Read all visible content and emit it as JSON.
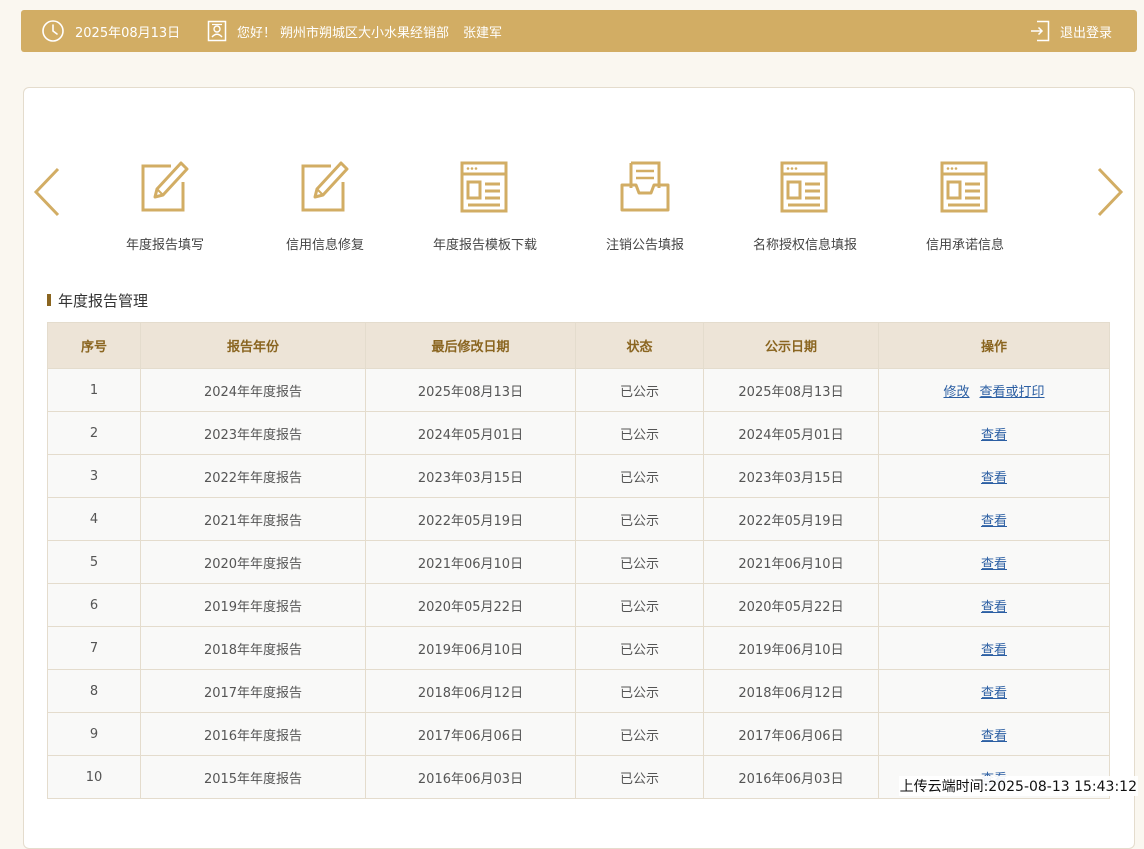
{
  "header": {
    "date": "2025年08月13日",
    "greeting": "您好！",
    "company": "朔州市朔城区大小水果经销部",
    "user": "张建军",
    "logout": "退出登录"
  },
  "quick_menu": [
    {
      "label": "年度报告填写",
      "icon": "edit-doc-icon"
    },
    {
      "label": "信用信息修复",
      "icon": "edit-doc-icon"
    },
    {
      "label": "年度报告模板下载",
      "icon": "template-icon"
    },
    {
      "label": "注销公告填报",
      "icon": "inbox-doc-icon"
    },
    {
      "label": "名称授权信息填报",
      "icon": "template-icon"
    },
    {
      "label": "信用承诺信息",
      "icon": "template-icon"
    }
  ],
  "section": {
    "title": "年度报告管理"
  },
  "table": {
    "headers": [
      "序号",
      "报告年份",
      "最后修改日期",
      "状态",
      "公示日期",
      "操作"
    ],
    "rows": [
      {
        "no": "1",
        "year": "2024年年度报告",
        "modified": "2025年08月13日",
        "status": "已公示",
        "published": "2025年08月13日",
        "actions": [
          "修改",
          "查看或打印"
        ]
      },
      {
        "no": "2",
        "year": "2023年年度报告",
        "modified": "2024年05月01日",
        "status": "已公示",
        "published": "2024年05月01日",
        "actions": [
          "查看"
        ]
      },
      {
        "no": "3",
        "year": "2022年年度报告",
        "modified": "2023年03月15日",
        "status": "已公示",
        "published": "2023年03月15日",
        "actions": [
          "查看"
        ]
      },
      {
        "no": "4",
        "year": "2021年年度报告",
        "modified": "2022年05月19日",
        "status": "已公示",
        "published": "2022年05月19日",
        "actions": [
          "查看"
        ]
      },
      {
        "no": "5",
        "year": "2020年年度报告",
        "modified": "2021年06月10日",
        "status": "已公示",
        "published": "2021年06月10日",
        "actions": [
          "查看"
        ]
      },
      {
        "no": "6",
        "year": "2019年年度报告",
        "modified": "2020年05月22日",
        "status": "已公示",
        "published": "2020年05月22日",
        "actions": [
          "查看"
        ]
      },
      {
        "no": "7",
        "year": "2018年年度报告",
        "modified": "2019年06月10日",
        "status": "已公示",
        "published": "2019年06月10日",
        "actions": [
          "查看"
        ]
      },
      {
        "no": "8",
        "year": "2017年年度报告",
        "modified": "2018年06月12日",
        "status": "已公示",
        "published": "2018年06月12日",
        "actions": [
          "查看"
        ]
      },
      {
        "no": "9",
        "year": "2016年年度报告",
        "modified": "2017年06月06日",
        "status": "已公示",
        "published": "2017年06月06日",
        "actions": [
          "查看"
        ]
      },
      {
        "no": "10",
        "year": "2015年年度报告",
        "modified": "2016年06月03日",
        "status": "已公示",
        "published": "2016年06月03日",
        "actions": [
          "查看"
        ]
      }
    ]
  },
  "footer": {
    "upload_time": "上传云端时间:2025-08-13 15:43:12"
  },
  "colors": {
    "accent": "#d2ad64",
    "header_text": "#8a6520",
    "link": "#2c5fa3"
  }
}
